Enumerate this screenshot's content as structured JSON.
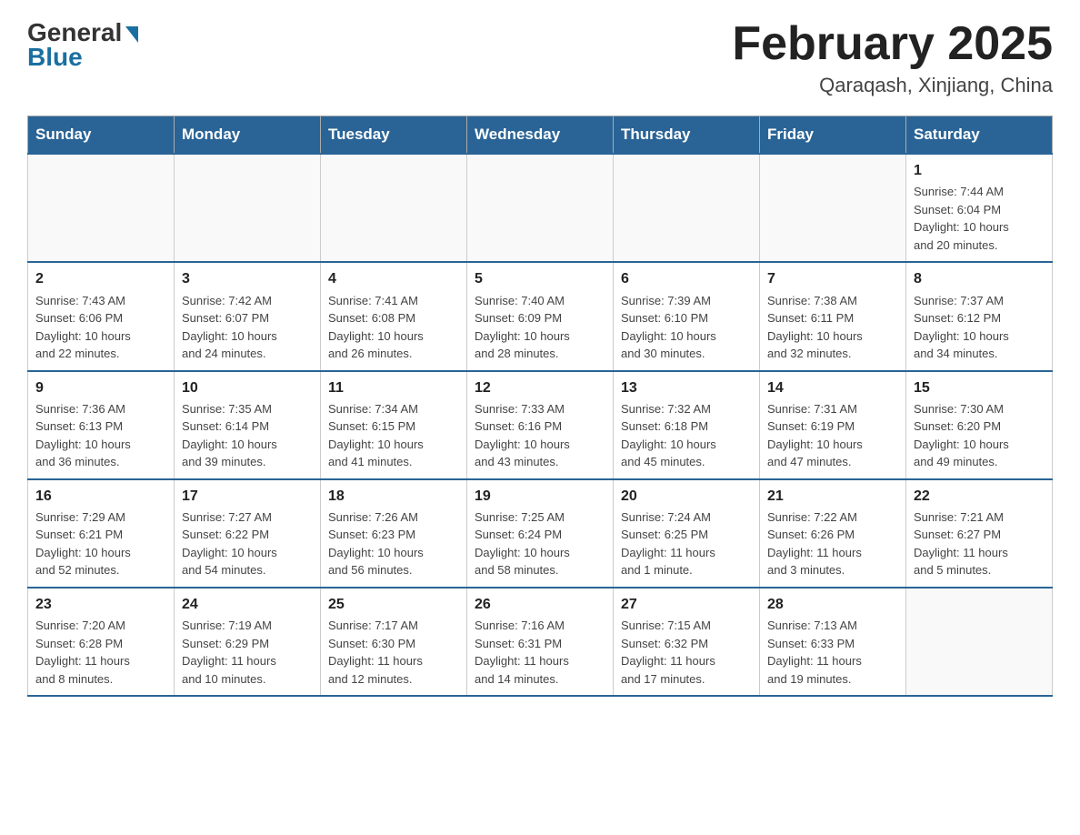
{
  "logo": {
    "general": "General",
    "blue": "Blue"
  },
  "header": {
    "month_title": "February 2025",
    "location": "Qaraqash, Xinjiang, China"
  },
  "weekdays": [
    "Sunday",
    "Monday",
    "Tuesday",
    "Wednesday",
    "Thursday",
    "Friday",
    "Saturday"
  ],
  "weeks": [
    [
      {
        "day": "",
        "info": ""
      },
      {
        "day": "",
        "info": ""
      },
      {
        "day": "",
        "info": ""
      },
      {
        "day": "",
        "info": ""
      },
      {
        "day": "",
        "info": ""
      },
      {
        "day": "",
        "info": ""
      },
      {
        "day": "1",
        "info": "Sunrise: 7:44 AM\nSunset: 6:04 PM\nDaylight: 10 hours\nand 20 minutes."
      }
    ],
    [
      {
        "day": "2",
        "info": "Sunrise: 7:43 AM\nSunset: 6:06 PM\nDaylight: 10 hours\nand 22 minutes."
      },
      {
        "day": "3",
        "info": "Sunrise: 7:42 AM\nSunset: 6:07 PM\nDaylight: 10 hours\nand 24 minutes."
      },
      {
        "day": "4",
        "info": "Sunrise: 7:41 AM\nSunset: 6:08 PM\nDaylight: 10 hours\nand 26 minutes."
      },
      {
        "day": "5",
        "info": "Sunrise: 7:40 AM\nSunset: 6:09 PM\nDaylight: 10 hours\nand 28 minutes."
      },
      {
        "day": "6",
        "info": "Sunrise: 7:39 AM\nSunset: 6:10 PM\nDaylight: 10 hours\nand 30 minutes."
      },
      {
        "day": "7",
        "info": "Sunrise: 7:38 AM\nSunset: 6:11 PM\nDaylight: 10 hours\nand 32 minutes."
      },
      {
        "day": "8",
        "info": "Sunrise: 7:37 AM\nSunset: 6:12 PM\nDaylight: 10 hours\nand 34 minutes."
      }
    ],
    [
      {
        "day": "9",
        "info": "Sunrise: 7:36 AM\nSunset: 6:13 PM\nDaylight: 10 hours\nand 36 minutes."
      },
      {
        "day": "10",
        "info": "Sunrise: 7:35 AM\nSunset: 6:14 PM\nDaylight: 10 hours\nand 39 minutes."
      },
      {
        "day": "11",
        "info": "Sunrise: 7:34 AM\nSunset: 6:15 PM\nDaylight: 10 hours\nand 41 minutes."
      },
      {
        "day": "12",
        "info": "Sunrise: 7:33 AM\nSunset: 6:16 PM\nDaylight: 10 hours\nand 43 minutes."
      },
      {
        "day": "13",
        "info": "Sunrise: 7:32 AM\nSunset: 6:18 PM\nDaylight: 10 hours\nand 45 minutes."
      },
      {
        "day": "14",
        "info": "Sunrise: 7:31 AM\nSunset: 6:19 PM\nDaylight: 10 hours\nand 47 minutes."
      },
      {
        "day": "15",
        "info": "Sunrise: 7:30 AM\nSunset: 6:20 PM\nDaylight: 10 hours\nand 49 minutes."
      }
    ],
    [
      {
        "day": "16",
        "info": "Sunrise: 7:29 AM\nSunset: 6:21 PM\nDaylight: 10 hours\nand 52 minutes."
      },
      {
        "day": "17",
        "info": "Sunrise: 7:27 AM\nSunset: 6:22 PM\nDaylight: 10 hours\nand 54 minutes."
      },
      {
        "day": "18",
        "info": "Sunrise: 7:26 AM\nSunset: 6:23 PM\nDaylight: 10 hours\nand 56 minutes."
      },
      {
        "day": "19",
        "info": "Sunrise: 7:25 AM\nSunset: 6:24 PM\nDaylight: 10 hours\nand 58 minutes."
      },
      {
        "day": "20",
        "info": "Sunrise: 7:24 AM\nSunset: 6:25 PM\nDaylight: 11 hours\nand 1 minute."
      },
      {
        "day": "21",
        "info": "Sunrise: 7:22 AM\nSunset: 6:26 PM\nDaylight: 11 hours\nand 3 minutes."
      },
      {
        "day": "22",
        "info": "Sunrise: 7:21 AM\nSunset: 6:27 PM\nDaylight: 11 hours\nand 5 minutes."
      }
    ],
    [
      {
        "day": "23",
        "info": "Sunrise: 7:20 AM\nSunset: 6:28 PM\nDaylight: 11 hours\nand 8 minutes."
      },
      {
        "day": "24",
        "info": "Sunrise: 7:19 AM\nSunset: 6:29 PM\nDaylight: 11 hours\nand 10 minutes."
      },
      {
        "day": "25",
        "info": "Sunrise: 7:17 AM\nSunset: 6:30 PM\nDaylight: 11 hours\nand 12 minutes."
      },
      {
        "day": "26",
        "info": "Sunrise: 7:16 AM\nSunset: 6:31 PM\nDaylight: 11 hours\nand 14 minutes."
      },
      {
        "day": "27",
        "info": "Sunrise: 7:15 AM\nSunset: 6:32 PM\nDaylight: 11 hours\nand 17 minutes."
      },
      {
        "day": "28",
        "info": "Sunrise: 7:13 AM\nSunset: 6:33 PM\nDaylight: 11 hours\nand 19 minutes."
      },
      {
        "day": "",
        "info": ""
      }
    ]
  ]
}
